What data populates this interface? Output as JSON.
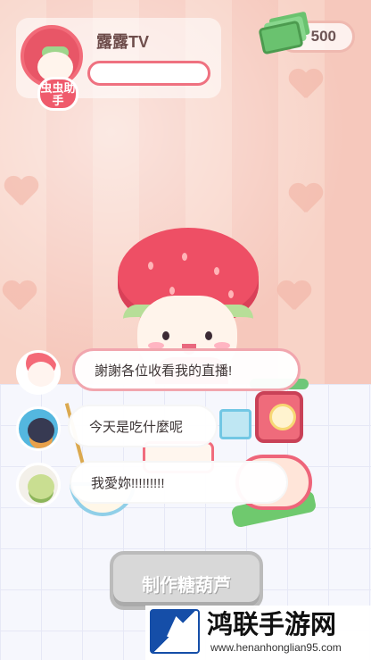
{
  "header": {
    "streamer_name": "露露TV",
    "assistant_badge": "虫虫助手",
    "money_value": "500"
  },
  "chat": {
    "messages": [
      {
        "text": "謝謝各位收看我的直播!"
      },
      {
        "text": "今天是吃什麼呢"
      },
      {
        "text": "我愛妳!!!!!!!!!"
      }
    ]
  },
  "controls": {
    "cook_button": "制作糖葫芦"
  },
  "watermark": {
    "site_name": "鸿联手游网",
    "url": "www.henanhonglian95.com"
  },
  "colors": {
    "primary": "#ee4f65",
    "background": "#f8d3c7",
    "button_disabled": "#d8d8d8"
  }
}
